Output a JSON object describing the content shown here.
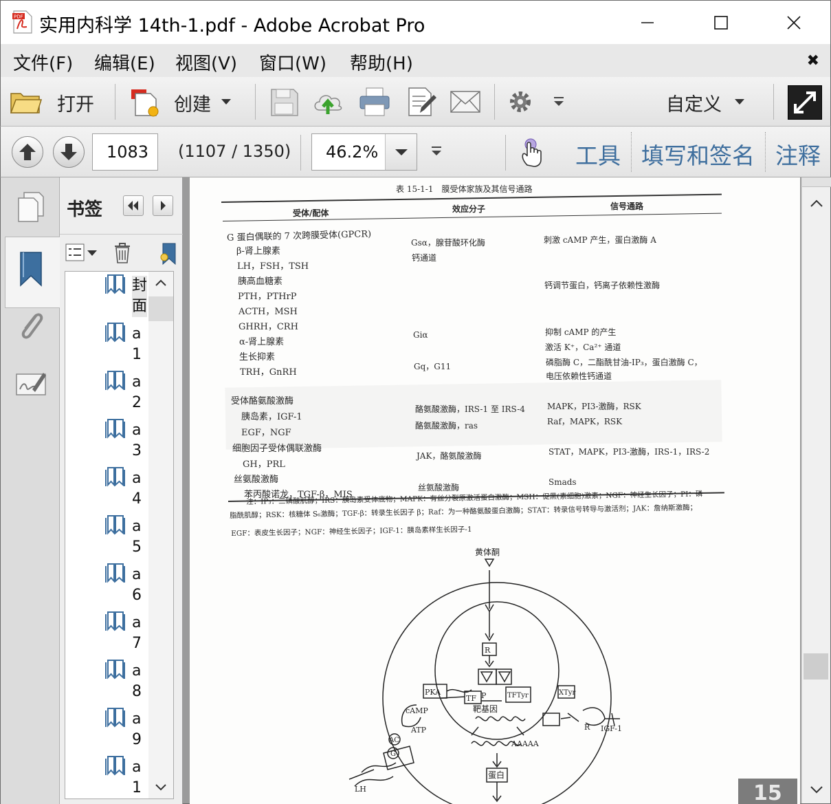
{
  "window": {
    "title": "实用内科学 14th-1.pdf - Adobe Acrobat Pro"
  },
  "menu": {
    "items": [
      "文件(F)",
      "编辑(E)",
      "视图(V)",
      "窗口(W)",
      "帮助(H)"
    ],
    "close_glyph": "✖"
  },
  "toolbar": {
    "open_label": "打开",
    "create_label": "创建",
    "customize_label": "自定义"
  },
  "nav": {
    "page_number": "1083",
    "page_count": "(1107 / 1350)",
    "zoom": "46.2%",
    "tools_label": "工具",
    "fill_sign_label": "填写和签名",
    "comment_label": "注释"
  },
  "bookmarks": {
    "title": "书签",
    "items": [
      {
        "label": "封面"
      },
      {
        "label": "a1"
      },
      {
        "label": "a2"
      },
      {
        "label": "a3"
      },
      {
        "label": "a4"
      },
      {
        "label": "a5"
      },
      {
        "label": "a6"
      },
      {
        "label": "a7"
      },
      {
        "label": "a8"
      },
      {
        "label": "a9"
      },
      {
        "label": "a1"
      }
    ]
  },
  "document": {
    "table_title": "表 15-1-1　膜受体家族及其信号通路",
    "headers": [
      "受体/配体",
      "效应分子",
      "信号通路"
    ],
    "col1": [
      "G 蛋白偶联的 7 次跨膜受体(GPCR)",
      "β-肾上腺素",
      "LH，FSH，TSH",
      "胰高血糖素",
      "PTH，PTHrP",
      "ACTH，MSH",
      "GHRH，CRH",
      "α-肾上腺素",
      "生长抑素",
      "TRH，GnRH",
      "受体酪氨酸激酶",
      "胰岛素，IGF-1",
      "EGF，NGF",
      "细胞因子受体偶联激酶",
      "GH，PRL",
      "丝氨酸激酶",
      "苯丙酸诺龙，TGF-β，MIS"
    ],
    "col2": [
      "Gsα，腺苷酸环化酶",
      "钙通道",
      "Giα",
      "Gq，G11",
      "酪氨酸激酶，IRS-1 至 IRS-4",
      "酪氨酸激酶，ras",
      "JAK，酪氨酸激酶",
      "丝氨酸激酶"
    ],
    "col3": [
      "刺激 cAMP 产生，蛋白激酶 A",
      "钙调节蛋白，钙离子依赖性激酶",
      "抑制 cAMP 的产生",
      "激活 K⁺，Ca²⁺ 通道",
      "磷脂酶 C，二酯酰甘油-IP₃，蛋白激酶 C，",
      "电压依赖性钙通道",
      "MAPK，PI3-激酶，RSK",
      "Raf，MAPK，RSK",
      "STAT，MAPK，PI3-激酶，IRS-1，IRS-2",
      "Smads"
    ],
    "notes": [
      "注：IP₃：三磷酸肌醇；IRS：胰岛素受体底物；MAPK：有丝分裂原激活蛋白激酶；MSH：促黑(素细胞)激素；NGF：神经生长因子；PI：磷",
      "脂酰肌醇；RSK：核糖体 S₆激酶；TGF-β：转录生长因子 β；Raf：为一种酪氨酸蛋白激酶；STAT：转录信号转导与激活剂；JAK：詹纳斯激酶；",
      "EGF：表皮生长因子；NGF：神经生长因子；IGF-1：胰岛素样生长因子-1"
    ],
    "diagram": {
      "top_label": "黄体酮",
      "r": "R",
      "pka": "PKA",
      "tf": "TF",
      "p": "P",
      "tf_tyr": "TFTyr",
      "x_tyr": "XTyr",
      "target_gene": "靶基因",
      "camp": "cAMP",
      "atp": "ATP",
      "ac": "AC",
      "g": "G",
      "aaaaa": "AAAAA",
      "protein": "蛋白",
      "lh": "LH",
      "igf": "IGF-1",
      "page_tab": "15"
    }
  }
}
